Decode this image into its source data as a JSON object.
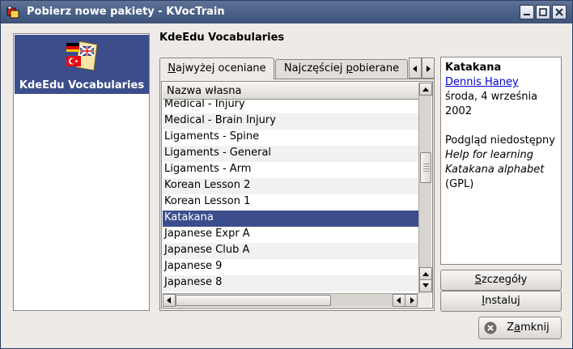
{
  "window": {
    "title": "Pobierz nowe pakiety - KVocTrain",
    "app_icon": "kvoctrain-icon",
    "controls": [
      "minimize-icon",
      "maximize-icon",
      "close-icon"
    ]
  },
  "providers": [
    {
      "label": "KdeEdu Vocabularies",
      "icon": "flags-icon",
      "selected": true
    }
  ],
  "section_title": "KdeEdu Vocabularies",
  "tabs": [
    {
      "label": "Najwyżej oceniane",
      "mnemonic_index": 0,
      "active": true
    },
    {
      "label": "Najczęściej pobierane",
      "mnemonic_index": 12,
      "active": false
    }
  ],
  "list": {
    "column_header": "Nazwa własna",
    "rows": [
      "Medical - Injury",
      "Medical - Brain Injury",
      "Ligaments - Spine",
      "Ligaments - General",
      "Ligaments - Arm",
      "Korean Lesson 2",
      "Korean Lesson 1",
      "Katakana",
      "Japanese Expr A",
      "Japanese Club A",
      "Japanese 9",
      "Japanese 8"
    ],
    "selected_index": 7
  },
  "details": {
    "name": "Katakana",
    "author": "Dennis Haney",
    "date": "środa, 4 września 2002",
    "preview": "Podgląd niedostępny",
    "description": "Help for learning Katakana alphabet",
    "license": "(GPL)"
  },
  "buttons": {
    "details": "Szczegóły",
    "install": "Instaluj",
    "close": "Zamknij"
  },
  "colors": {
    "titlebar": "#4a5f86",
    "selection": "#3c4d8c",
    "link": "#0000cc",
    "window_bg": "#eeeae7"
  }
}
